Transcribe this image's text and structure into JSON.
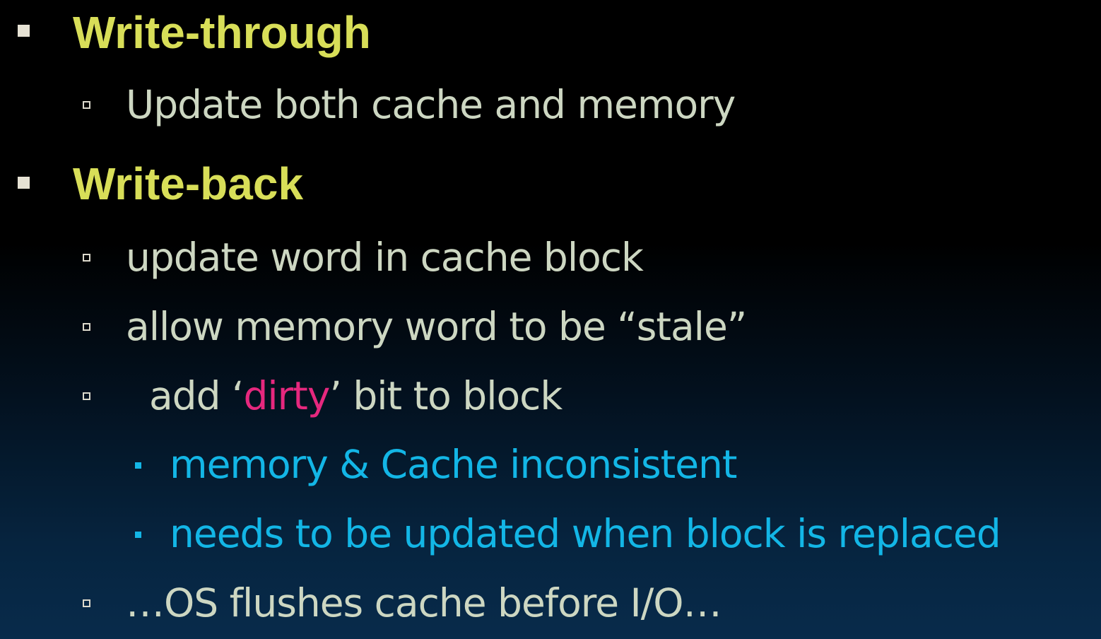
{
  "slide": {
    "items": [
      {
        "level": 1,
        "text": "Write-through"
      },
      {
        "level": 2,
        "text": "Update both cache and memory"
      },
      {
        "level": 1,
        "text": "Write-back"
      },
      {
        "level": 2,
        "text": "update word in cache block"
      },
      {
        "level": 2,
        "text": "allow memory word to be “stale”"
      },
      {
        "level": 2,
        "prefix": "  add ‘",
        "highlight": "dirty",
        "suffix": "’ bit to block"
      },
      {
        "level": 3,
        "text": "memory & Cache inconsistent"
      },
      {
        "level": 3,
        "text": "needs to be updated when block is replaced"
      },
      {
        "level": 2,
        "text": "…OS flushes cache before I/O…"
      }
    ]
  },
  "colors": {
    "heading": "#d8de58",
    "body": "#cdd7c2",
    "subpoint": "#13b6e6",
    "highlight": "#e6287e",
    "background_top": "#000000",
    "background_bottom": "#082b4b"
  }
}
